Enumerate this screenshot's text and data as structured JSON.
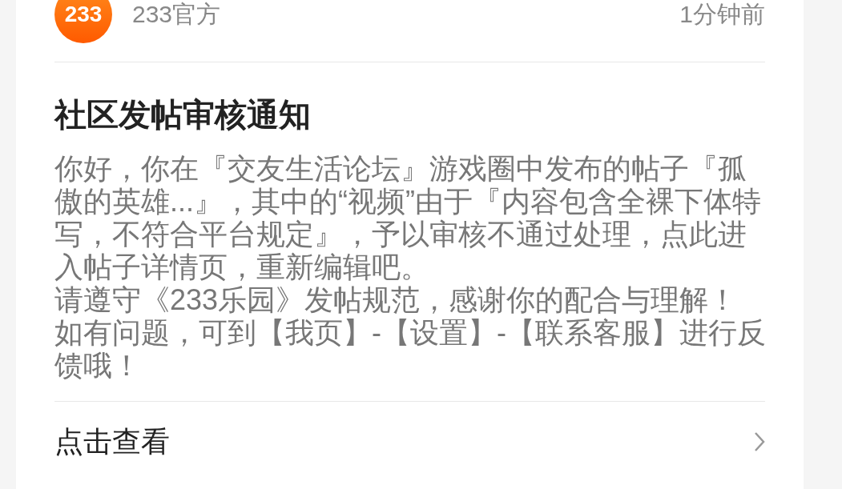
{
  "header": {
    "avatar_text": "233",
    "sender": "233官方",
    "time": "1分钟前"
  },
  "notice": {
    "title": "社区发帖审核通知",
    "paragraphs": [
      "你好，你在『交友生活论坛』游戏圈中发布的帖子『孤傲的英雄...』，其中的“视频”由于『内容包含全裸下体特写，不符合平台规定』，予以审核不通过处理，点此进入帖子详情页，重新编辑吧。",
      "请遵守《233乐园》发帖规范，感谢你的配合与理解！",
      "如有问题，可到【我页】-【设置】-【联系客服】进行反馈哦！"
    ]
  },
  "action": {
    "label": "点击查看"
  }
}
